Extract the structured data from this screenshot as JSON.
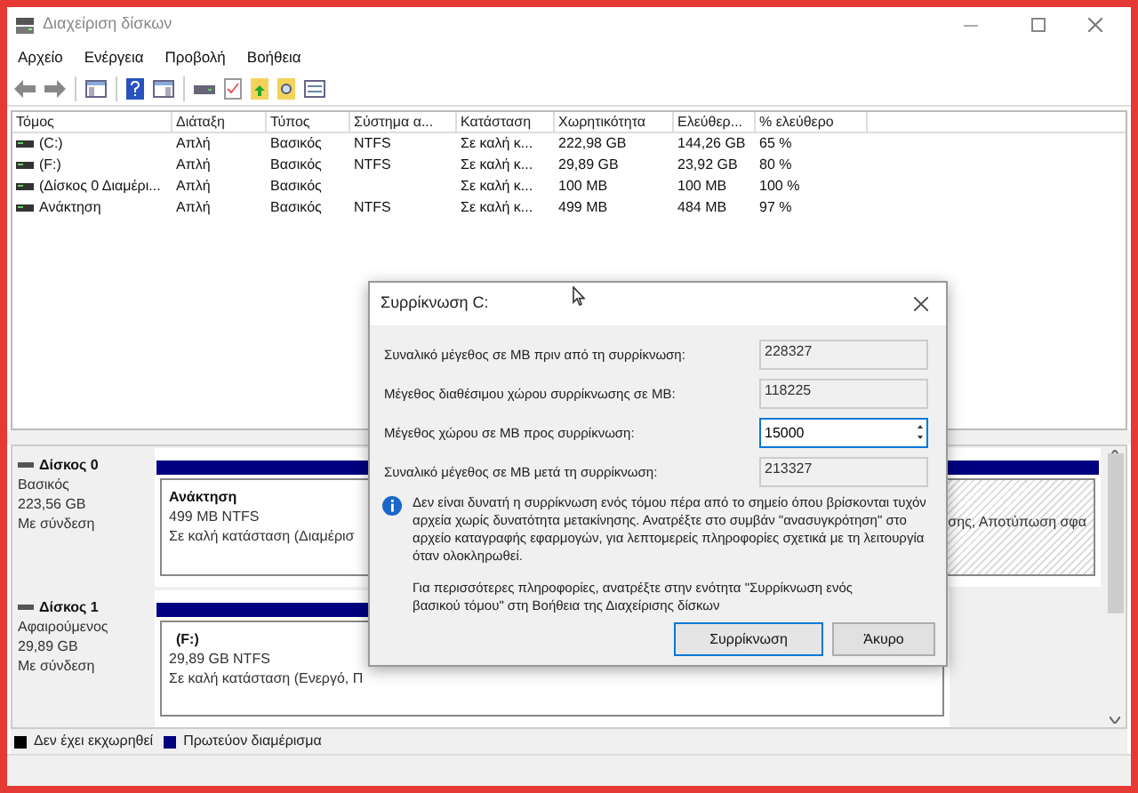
{
  "window": {
    "title": "Διαχείριση δίσκων"
  },
  "menu": [
    "Αρχείο",
    "Ενέργεια",
    "Προβολή",
    "Βοήθεια"
  ],
  "volumes": {
    "columns": [
      "Τόμος",
      "Διάταξη",
      "Τύπος",
      "Σύστημα α...",
      "Κατάσταση",
      "Χωρητικότητα",
      "Ελεύθερ...",
      "% ελεύθερο"
    ],
    "rows": [
      [
        "(C:)",
        "Απλή",
        "Βασικός",
        "NTFS",
        "Σε καλή κ...",
        "222,98 GB",
        "144,26 GB",
        "65 %"
      ],
      [
        "(F:)",
        "Απλή",
        "Βασικός",
        "NTFS",
        "Σε καλή κ...",
        "29,89 GB",
        "23,92 GB",
        "80 %"
      ],
      [
        "(Δίσκος 0 Διαμέρι...",
        "Απλή",
        "Βασικός",
        "",
        "Σε καλή κ...",
        "100 MB",
        "100 MB",
        "100 %"
      ],
      [
        "Ανάκτηση",
        "Απλή",
        "Βασικός",
        "NTFS",
        "Σε καλή κ...",
        "499 MB",
        "484 MB",
        "97 %"
      ]
    ]
  },
  "disks": [
    {
      "name": "Δίσκος 0",
      "type": "Βασικός",
      "size": "223,56 GB",
      "status": "Με σύνδεση",
      "partitions": [
        {
          "name": "Ανάκτηση",
          "size": "499 MB NTFS",
          "status": "Σε καλή κατάσταση (Διαμέρισ",
          "selected": false
        },
        {
          "status": "σης, Αποτύπωση σφα",
          "selected": true
        }
      ]
    },
    {
      "name": "Δίσκος 1",
      "type": "Αφαιρούμενος",
      "size": "29,89 GB",
      "status": "Με σύνδεση",
      "partitions": [
        {
          "name": "(F:)",
          "size": "29,89 GB NTFS",
          "status": "Σε καλή κατάσταση (Ενεργό, Π",
          "selected": false
        }
      ]
    }
  ],
  "legend": [
    {
      "label": "Δεν έχει εκχωρηθεί",
      "color": "#000000"
    },
    {
      "label": "Πρωτεύον διαμέρισμα",
      "color": "#000080"
    }
  ],
  "dialog": {
    "title": "Συρρίκνωση C:",
    "fields": [
      {
        "label": "Συναλικό μέγεθος σε MB πριν από τη συρρίκνωση:",
        "value": "228327",
        "kind": "readonly"
      },
      {
        "label": "Μέγεθος διαθέσιμου χώρου συρρίκνωσης σε MB:",
        "value": "118225",
        "kind": "readonly"
      },
      {
        "label": "Μέγεθος χώρου σε MB προς συρρίκνωση:",
        "value": "15000",
        "kind": "spin"
      },
      {
        "label": "Συναλικό μέγεθος σε MB μετά τη συρρίκνωση:",
        "value": "213327",
        "kind": "readonly"
      }
    ],
    "info": "Δεν είναι δυνατή η συρρίκνωση ενός τόμου πέρα από το σημείο όπου βρίσκονται τυχόν αρχεία χωρίς δυνατότητα μετακίνησης. Ανατρέξτε στο συμβάν \"ανασυγκρότηση\" στο αρχείο καταγραφής εφαρμογών, για λεπτομερείς πληροφορίες σχετικά με τη λειτουργία όταν ολοκληρωθεί.",
    "help": "Για περισσότερες πληροφορίες, ανατρέξτε στην ενότητα \"Συρρίκνωση ενός βασικού τόμου\" στη Βοήθεια της Διαχείρισης δίσκων",
    "buttons": [
      {
        "label": "Συρρίκνωση",
        "default": true
      },
      {
        "label": "Άκυρο",
        "default": false
      }
    ]
  }
}
